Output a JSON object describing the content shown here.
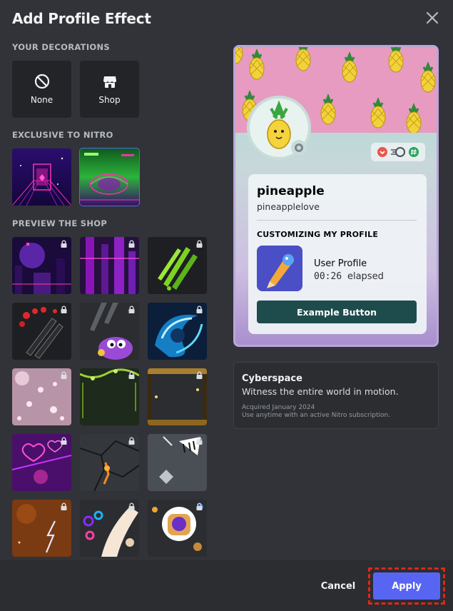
{
  "modal": {
    "title": "Add Profile Effect"
  },
  "sections": {
    "your_decorations": "YOUR DECORATIONS",
    "exclusive": "EXCLUSIVE TO NITRO",
    "preview_shop": "PREVIEW THE SHOP"
  },
  "decorations": [
    {
      "label": "None",
      "icon": "none-icon"
    },
    {
      "label": "Shop",
      "icon": "shop-icon"
    }
  ],
  "exclusive_tiles": [
    {
      "name": "cyber-cube",
      "selected": false
    },
    {
      "name": "cyberspace",
      "selected": true
    }
  ],
  "shop_tiles_locked": true,
  "profile": {
    "display_name": "pineapple",
    "username": "pineapplelove",
    "section_title": "CUSTOMIZING MY PROFILE",
    "activity_title": "User Profile",
    "activity_time": "00:26",
    "activity_suffix": "elapsed",
    "button_label": "Example Button"
  },
  "effect_info": {
    "name": "Cyberspace",
    "description": "Witness the entire world in motion.",
    "acquired": "Acquired January 2024",
    "usage": "Use anytime with an active Nitro subscription."
  },
  "footer": {
    "cancel": "Cancel",
    "apply": "Apply"
  },
  "colors": {
    "accent": "#5865f2",
    "highlight": "#e0261a",
    "example_button": "#1e4c4c"
  }
}
